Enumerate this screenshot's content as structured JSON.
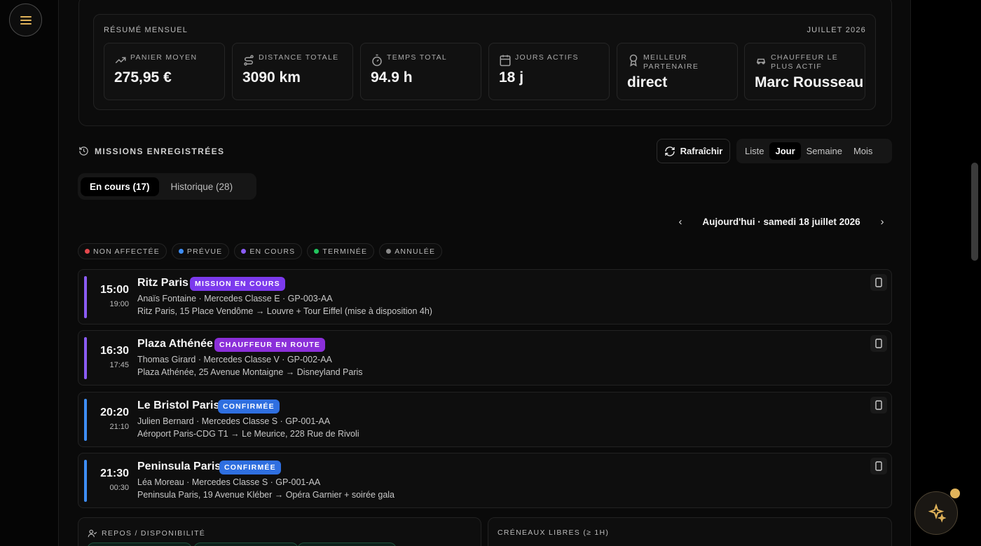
{
  "summary": {
    "label": "RÉSUMÉ MENSUEL",
    "month": "JUILLET 2026",
    "stats": [
      {
        "icon": "trending-up-icon",
        "label": "PANIER MOYEN",
        "value": "275,95 €"
      },
      {
        "icon": "route-icon",
        "label": "DISTANCE TOTALE",
        "value": "3090 km"
      },
      {
        "icon": "timer-icon",
        "label": "TEMPS TOTAL",
        "value": "94.9 h"
      },
      {
        "icon": "calendar-icon",
        "label": "JOURS ACTIFS",
        "value": "18 j"
      },
      {
        "icon": "award-icon",
        "label": "MEILLEUR PARTENAIRE",
        "value": "direct"
      },
      {
        "icon": "car-icon",
        "label": "CHAUFFEUR LE PLUS ACTIF",
        "value": "Marc Rousseau"
      }
    ]
  },
  "missions_header": {
    "title": "MISSIONS ENREGISTRÉES",
    "refresh": "Rafraîchir"
  },
  "views": [
    "Liste",
    "Jour",
    "Semaine",
    "Mois"
  ],
  "active_view": "Jour",
  "tabs": [
    {
      "label": "En cours (17)",
      "active": true
    },
    {
      "label": "Historique (28)",
      "active": false
    }
  ],
  "date_label": "Aujourd'hui · samedi 18 juillet 2026",
  "legend": [
    {
      "label": "NON AFFECTÉE",
      "color": "#e5484d"
    },
    {
      "label": "PRÉVUE",
      "color": "#3e8ef7"
    },
    {
      "label": "EN COURS",
      "color": "#8b5cf6"
    },
    {
      "label": "TERMINÉE",
      "color": "#22c55e"
    },
    {
      "label": "ANNULÉE",
      "color": "#8a8a8a"
    }
  ],
  "missions": [
    {
      "start": "15:00",
      "end": "19:00",
      "name": "Ritz Paris",
      "badge": "MISSION EN COURS",
      "badge_color": "#7c3aed",
      "bar_color": "#8b5cf6",
      "details": "Anaïs Fontaine · Mercedes Classe E · GP-003-AA",
      "route": "Ritz Paris, 15 Place Vendôme → Louvre + Tour Eiffel (mise à disposition 4h)"
    },
    {
      "start": "16:30",
      "end": "17:45",
      "name": "Plaza Athénée",
      "badge": "CHAUFFEUR EN ROUTE",
      "badge_color": "#8b2fd9",
      "bar_color": "#8b5cf6",
      "details": "Thomas Girard · Mercedes Classe V · GP-002-AA",
      "route": "Plaza Athénée, 25 Avenue Montaigne → Disneyland Paris"
    },
    {
      "start": "20:20",
      "end": "21:10",
      "name": "Le Bristol Paris",
      "badge": "CONFIRMÉE",
      "badge_color": "#2f6fe0",
      "bar_color": "#3e8ef7",
      "details": "Julien Bernard · Mercedes Classe S · GP-001-AA",
      "route": "Aéroport Paris-CDG T1 → Le Meurice, 228 Rue de Rivoli"
    },
    {
      "start": "21:30",
      "end": "00:30",
      "name": "Peninsula Paris",
      "badge": "CONFIRMÉE",
      "badge_color": "#2f6fe0",
      "bar_color": "#3e8ef7",
      "details": "Léa Moreau · Mercedes Classe S · GP-001-AA",
      "route": "Peninsula Paris, 19 Avenue Kléber → Opéra Garnier + soirée gala"
    }
  ],
  "bottom": {
    "rest_title": "REPOS / DISPONIBILITÉ",
    "slots_title": "CRÉNEAUX LIBRES (≥ 1H)"
  }
}
